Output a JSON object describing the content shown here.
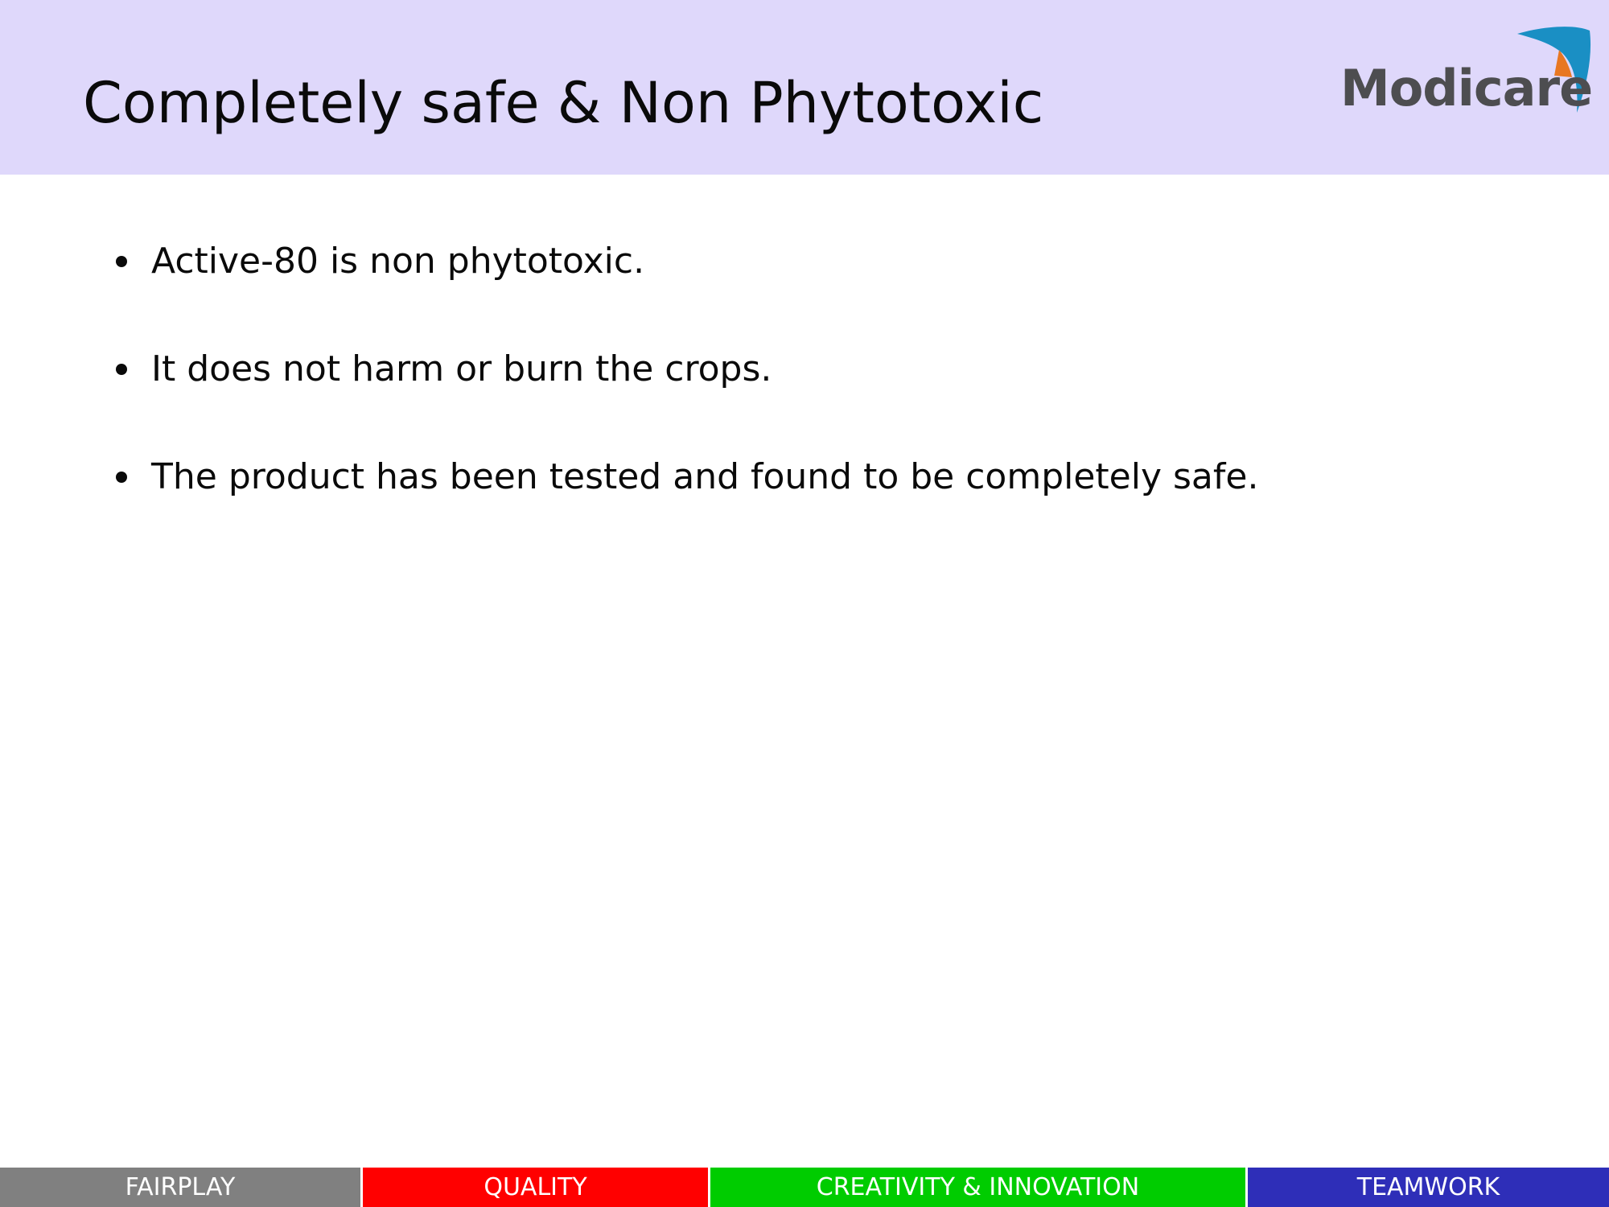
{
  "slide": {
    "title": "Completely safe & Non Phytotoxic",
    "logo": {
      "text": "Modicare",
      "mark_icon": "modicare-swoosh-icon",
      "text_color": "#4d4d50",
      "mark_colors": [
        "#1a8fc4",
        "#e87722"
      ]
    },
    "header_color": "#dfd8fb",
    "bullets": [
      {
        "text": "Active-80 is non phytotoxic."
      },
      {
        "text": "It does not harm or burn the crops."
      },
      {
        "text": "The product has been tested and found to be completely safe."
      }
    ],
    "footer": [
      {
        "label": "FAIRPLAY",
        "color": "#808080"
      },
      {
        "label": "QUALITY",
        "color": "#ff0000"
      },
      {
        "label": "CREATIVITY & INNOVATION",
        "color": "#00cc00"
      },
      {
        "label": "TEAMWORK",
        "color": "#2e2eb8"
      }
    ]
  }
}
